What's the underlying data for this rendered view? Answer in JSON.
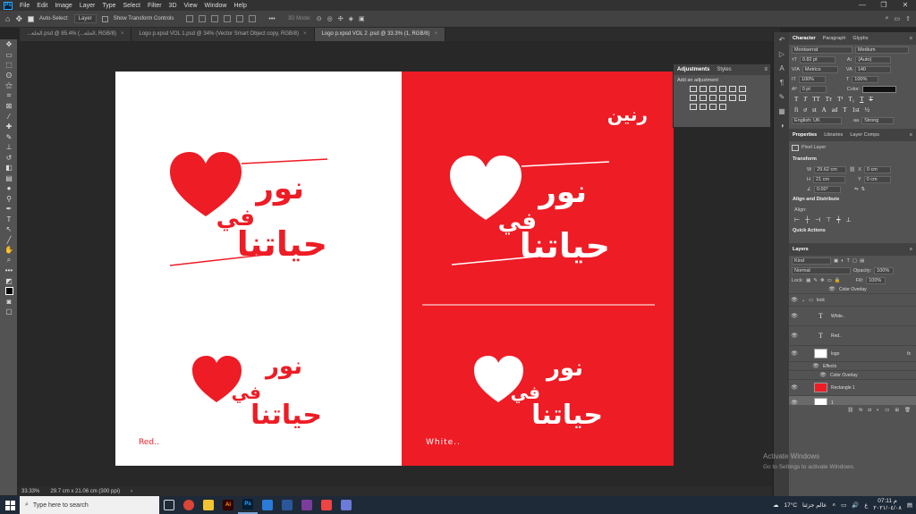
{
  "menu": [
    "File",
    "Edit",
    "Image",
    "Layer",
    "Type",
    "Select",
    "Filter",
    "3D",
    "View",
    "Window",
    "Help"
  ],
  "options": {
    "auto_select": "Auto-Select:",
    "auto_select_value": "Layer",
    "show_transform": "Show Transform Controls",
    "mode_3d": "3D Mode:"
  },
  "tabs": [
    {
      "label": "...الحلة.psd @ 85.4% (...الحلة, RGB/8)",
      "active": false
    },
    {
      "label": "Logo p.xpsd VOL 1.psd @ 34% (Vector Smart Object copy, RGB/8)",
      "active": false
    },
    {
      "label": "Logo p.xpsd VOL 2 .psd @ 33.3% (1, RGB/8)",
      "active": true
    }
  ],
  "artboard": {
    "red_caption": "Red..",
    "white_caption": "White..",
    "brand": "رنين",
    "line1": "نور",
    "line2": "في",
    "line3": "حياتنا",
    "colors": {
      "red": "#ee1c25",
      "white": "#ffffff"
    }
  },
  "adjustments": {
    "tab1": "Adjustments",
    "tab2": "Styles",
    "subtitle": "Add an adjustment"
  },
  "status": {
    "zoom": "33.33%",
    "dims": "29.7 cm x 21.06 cm (300 ppi)"
  },
  "character": {
    "tabs": [
      "Character",
      "Paragraph",
      "Glyphs"
    ],
    "font": "Montserrat",
    "style": "Medium",
    "size": "0.82 pt",
    "leading": "(Auto)",
    "kerning": "Metrics",
    "tracking": "140",
    "vscale": "100%",
    "hscale": "100%",
    "baseline": "0 pt",
    "color_label": "Color:",
    "language": "English: UK",
    "aa": "aa",
    "aa_mode": "Strong"
  },
  "properties": {
    "tabs": [
      "Properties",
      "Libraries",
      "Layer Comps"
    ],
    "kind": "Pixel Layer",
    "transform": "Transform",
    "w_label": "W",
    "w": "29.62 cm",
    "x_label": "X",
    "x": "0 cm",
    "h_label": "H",
    "h": "21 cm",
    "y_label": "Y",
    "y": "0 cm",
    "angle": "0.00°",
    "align": "Align and Distribute",
    "align_sub": "Align:",
    "quick": "Quick Actions"
  },
  "layers": {
    "title": "Layers",
    "kind": "Kind",
    "blend": "Normal",
    "opacity_label": "Opacity:",
    "opacity": "100%",
    "lock_label": "Lock:",
    "fill_label": "Fill:",
    "fill": "100%",
    "items": [
      {
        "name": "Color Overlay",
        "type": "effect"
      },
      {
        "name": "lock",
        "type": "group"
      },
      {
        "name": "White..",
        "type": "text"
      },
      {
        "name": "Red..",
        "type": "text"
      },
      {
        "name": "logo",
        "type": "smart"
      },
      {
        "name": "Effects",
        "type": "effect"
      },
      {
        "name": "Color Overlay",
        "type": "effect"
      },
      {
        "name": "Rectangle 1",
        "type": "shape"
      },
      {
        "name": "1",
        "type": "pixel"
      }
    ]
  },
  "watermark": {
    "line1": "Activate Windows",
    "line2": "Go to Settings to activate Windows."
  },
  "taskbar": {
    "search": "Type here to search",
    "temp": "17°C",
    "weather": "عالم جزئنا",
    "time": "07:11 م",
    "date": "٢٠٢١/٠٤/٠٨",
    "lang": "ع"
  }
}
